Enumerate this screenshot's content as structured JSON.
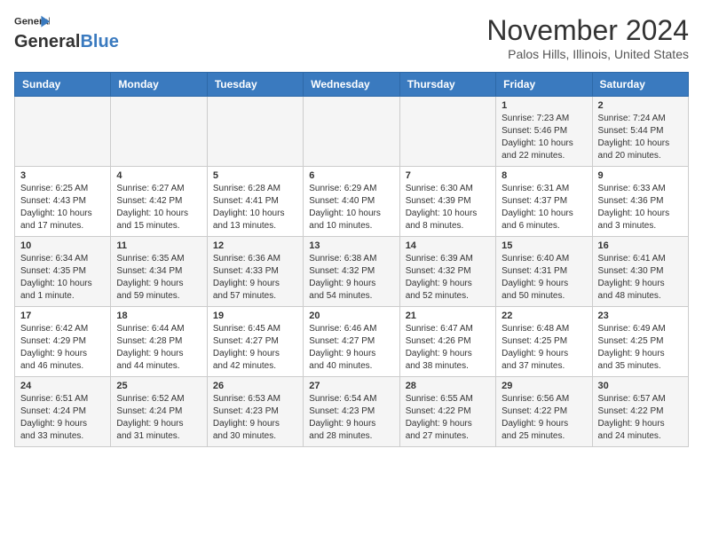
{
  "header": {
    "logo_line1": "General",
    "logo_line2": "Blue",
    "month": "November 2024",
    "location": "Palos Hills, Illinois, United States"
  },
  "weekdays": [
    "Sunday",
    "Monday",
    "Tuesday",
    "Wednesday",
    "Thursday",
    "Friday",
    "Saturday"
  ],
  "weeks": [
    [
      {
        "day": "",
        "info": ""
      },
      {
        "day": "",
        "info": ""
      },
      {
        "day": "",
        "info": ""
      },
      {
        "day": "",
        "info": ""
      },
      {
        "day": "",
        "info": ""
      },
      {
        "day": "1",
        "info": "Sunrise: 7:23 AM\nSunset: 5:46 PM\nDaylight: 10 hours\nand 22 minutes."
      },
      {
        "day": "2",
        "info": "Sunrise: 7:24 AM\nSunset: 5:44 PM\nDaylight: 10 hours\nand 20 minutes."
      }
    ],
    [
      {
        "day": "3",
        "info": "Sunrise: 6:25 AM\nSunset: 4:43 PM\nDaylight: 10 hours\nand 17 minutes."
      },
      {
        "day": "4",
        "info": "Sunrise: 6:27 AM\nSunset: 4:42 PM\nDaylight: 10 hours\nand 15 minutes."
      },
      {
        "day": "5",
        "info": "Sunrise: 6:28 AM\nSunset: 4:41 PM\nDaylight: 10 hours\nand 13 minutes."
      },
      {
        "day": "6",
        "info": "Sunrise: 6:29 AM\nSunset: 4:40 PM\nDaylight: 10 hours\nand 10 minutes."
      },
      {
        "day": "7",
        "info": "Sunrise: 6:30 AM\nSunset: 4:39 PM\nDaylight: 10 hours\nand 8 minutes."
      },
      {
        "day": "8",
        "info": "Sunrise: 6:31 AM\nSunset: 4:37 PM\nDaylight: 10 hours\nand 6 minutes."
      },
      {
        "day": "9",
        "info": "Sunrise: 6:33 AM\nSunset: 4:36 PM\nDaylight: 10 hours\nand 3 minutes."
      }
    ],
    [
      {
        "day": "10",
        "info": "Sunrise: 6:34 AM\nSunset: 4:35 PM\nDaylight: 10 hours\nand 1 minute."
      },
      {
        "day": "11",
        "info": "Sunrise: 6:35 AM\nSunset: 4:34 PM\nDaylight: 9 hours\nand 59 minutes."
      },
      {
        "day": "12",
        "info": "Sunrise: 6:36 AM\nSunset: 4:33 PM\nDaylight: 9 hours\nand 57 minutes."
      },
      {
        "day": "13",
        "info": "Sunrise: 6:38 AM\nSunset: 4:32 PM\nDaylight: 9 hours\nand 54 minutes."
      },
      {
        "day": "14",
        "info": "Sunrise: 6:39 AM\nSunset: 4:32 PM\nDaylight: 9 hours\nand 52 minutes."
      },
      {
        "day": "15",
        "info": "Sunrise: 6:40 AM\nSunset: 4:31 PM\nDaylight: 9 hours\nand 50 minutes."
      },
      {
        "day": "16",
        "info": "Sunrise: 6:41 AM\nSunset: 4:30 PM\nDaylight: 9 hours\nand 48 minutes."
      }
    ],
    [
      {
        "day": "17",
        "info": "Sunrise: 6:42 AM\nSunset: 4:29 PM\nDaylight: 9 hours\nand 46 minutes."
      },
      {
        "day": "18",
        "info": "Sunrise: 6:44 AM\nSunset: 4:28 PM\nDaylight: 9 hours\nand 44 minutes."
      },
      {
        "day": "19",
        "info": "Sunrise: 6:45 AM\nSunset: 4:27 PM\nDaylight: 9 hours\nand 42 minutes."
      },
      {
        "day": "20",
        "info": "Sunrise: 6:46 AM\nSunset: 4:27 PM\nDaylight: 9 hours\nand 40 minutes."
      },
      {
        "day": "21",
        "info": "Sunrise: 6:47 AM\nSunset: 4:26 PM\nDaylight: 9 hours\nand 38 minutes."
      },
      {
        "day": "22",
        "info": "Sunrise: 6:48 AM\nSunset: 4:25 PM\nDaylight: 9 hours\nand 37 minutes."
      },
      {
        "day": "23",
        "info": "Sunrise: 6:49 AM\nSunset: 4:25 PM\nDaylight: 9 hours\nand 35 minutes."
      }
    ],
    [
      {
        "day": "24",
        "info": "Sunrise: 6:51 AM\nSunset: 4:24 PM\nDaylight: 9 hours\nand 33 minutes."
      },
      {
        "day": "25",
        "info": "Sunrise: 6:52 AM\nSunset: 4:24 PM\nDaylight: 9 hours\nand 31 minutes."
      },
      {
        "day": "26",
        "info": "Sunrise: 6:53 AM\nSunset: 4:23 PM\nDaylight: 9 hours\nand 30 minutes."
      },
      {
        "day": "27",
        "info": "Sunrise: 6:54 AM\nSunset: 4:23 PM\nDaylight: 9 hours\nand 28 minutes."
      },
      {
        "day": "28",
        "info": "Sunrise: 6:55 AM\nSunset: 4:22 PM\nDaylight: 9 hours\nand 27 minutes."
      },
      {
        "day": "29",
        "info": "Sunrise: 6:56 AM\nSunset: 4:22 PM\nDaylight: 9 hours\nand 25 minutes."
      },
      {
        "day": "30",
        "info": "Sunrise: 6:57 AM\nSunset: 4:22 PM\nDaylight: 9 hours\nand 24 minutes."
      }
    ]
  ]
}
